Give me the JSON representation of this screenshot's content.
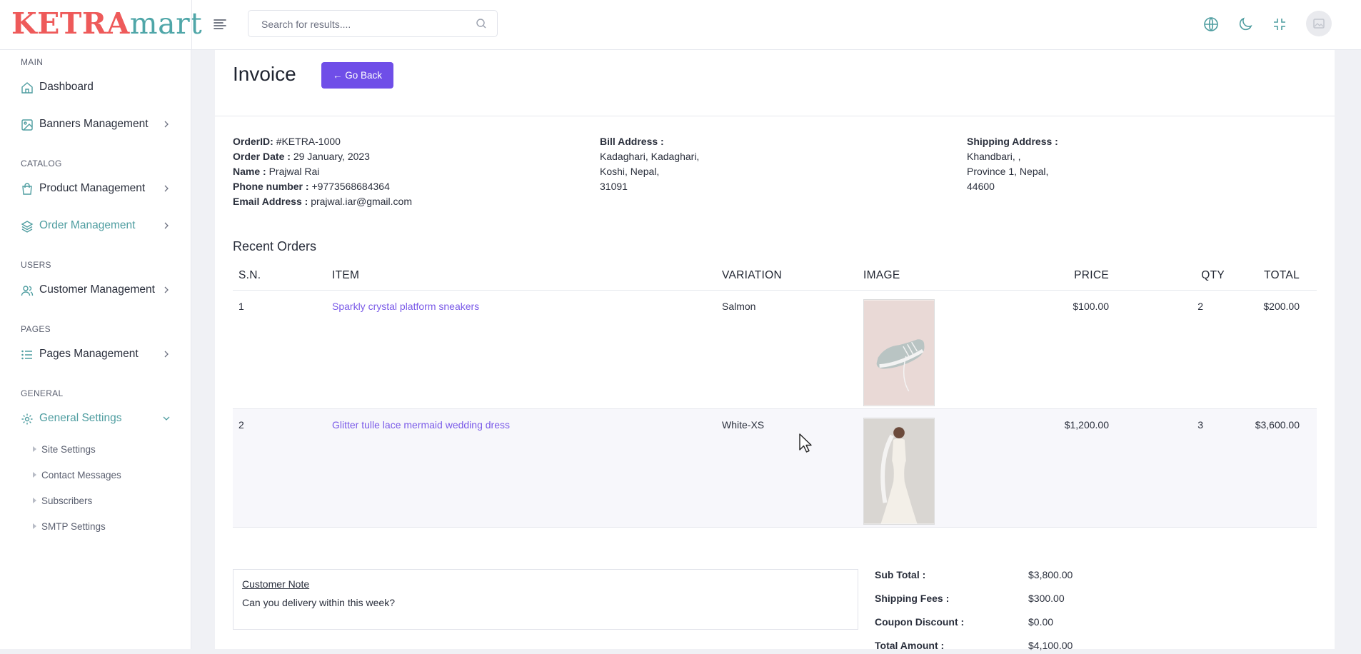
{
  "brand": {
    "part1": "KETRA",
    "part2": "mart",
    "primary_color": "#ee5a5a",
    "secondary_color": "#4fa6a8"
  },
  "header": {
    "search_placeholder": "Search for results....",
    "icons": [
      "menu-toggle-icon",
      "search-icon",
      "globe-icon",
      "moon-icon",
      "collapse-icon",
      "user-avatar"
    ]
  },
  "sidebar": {
    "sections": {
      "main": "MAIN",
      "catalog": "CATALOG",
      "users": "USERS",
      "pages": "PAGES",
      "general": "GENERAL"
    },
    "items": {
      "dashboard": "Dashboard",
      "banners": "Banners Management",
      "products": "Product Management",
      "orders": "Order Management",
      "customers": "Customer Management",
      "pages": "Pages Management",
      "settings": "General Settings"
    },
    "sub_items": [
      "Site Settings",
      "Contact Messages",
      "Subscribers",
      "SMTP Settings"
    ],
    "active_color": "#4e9da0"
  },
  "invoice": {
    "title": "Invoice",
    "back_label": "Go Back",
    "accent_color": "#6f4ee8",
    "order": {
      "id_label": "OrderID:",
      "id_value": "#KETRA-1000",
      "date_label": "Order Date :",
      "date_value": "29 January, 2023",
      "name_label": "Name :",
      "name_value": "Prajwal Rai",
      "phone_label": "Phone number :",
      "phone_value": "+9773568684364",
      "email_label": "Email Address :",
      "email_value": "prajwal.iar@gmail.com"
    },
    "bill": {
      "label": "Bill Address :",
      "line1": "Kadaghari, Kadaghari,",
      "line2": "Koshi, Nepal,",
      "line3": "31091"
    },
    "ship": {
      "label": "Shipping Address :",
      "line1": "Khandbari, ,",
      "line2": "Province 1, Nepal,",
      "line3": "44600"
    },
    "recent_title": "Recent Orders",
    "columns": {
      "sn": "S.N.",
      "item": "ITEM",
      "variation": "VARIATION",
      "image": "IMAGE",
      "price": "PRICE",
      "qty": "QTY",
      "total": "TOTAL"
    },
    "rows": [
      {
        "sn": "1",
        "item": "Sparkly crystal platform sneakers",
        "variation": "Salmon",
        "image": "sneaker-photo",
        "price": "$100.00",
        "qty": "2",
        "total": "$200.00"
      },
      {
        "sn": "2",
        "item": "Glitter tulle lace mermaid wedding dress",
        "variation": "White-XS",
        "image": "wedding-dress-photo",
        "price": "$1,200.00",
        "qty": "3",
        "total": "$3,600.00"
      }
    ],
    "note": {
      "title": "Customer Note",
      "text": "Can you delivery within this week?"
    },
    "totals": {
      "sub_label": "Sub Total :",
      "sub_value": "$3,800.00",
      "ship_label": "Shipping Fees :",
      "ship_value": "$300.00",
      "coupon_label": "Coupon Discount :",
      "coupon_value": "$0.00",
      "total_label": "Total Amount :",
      "total_value": "$4,100.00"
    }
  }
}
